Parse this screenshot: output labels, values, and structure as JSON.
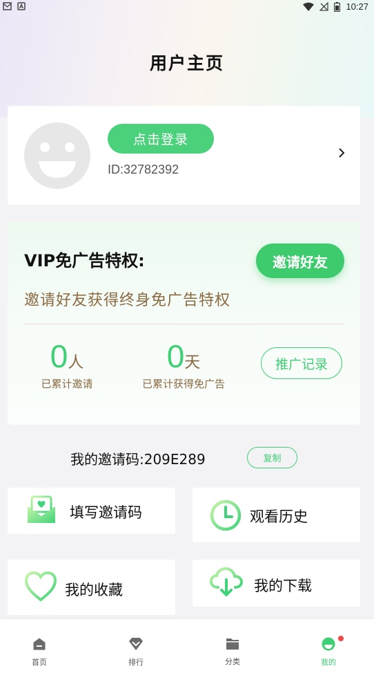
{
  "status_bar": {
    "time": "10:27"
  },
  "page": {
    "title": "用户主页"
  },
  "profile": {
    "login_label": "点击登录",
    "user_id": "ID:32782392"
  },
  "vip": {
    "title": "VIP免广告特权:",
    "invite_label": "邀请好友",
    "subtitle": "邀请好友获得终身免广告特权",
    "invited_count": "0",
    "invited_unit": "人",
    "invited_label": "已累计邀请",
    "days_count": "0",
    "days_unit": "天",
    "days_label": "已累计获得免广告",
    "record_label": "推广记录"
  },
  "invite_code": {
    "label": "我的邀请码:209E289",
    "copy_label": "复制"
  },
  "tiles": {
    "fill_code": "填写邀请码",
    "history": "观看历史",
    "favorites": "我的收藏",
    "downloads": "我的下载"
  },
  "tabbar": {
    "home": "首页",
    "ranking": "排行",
    "category": "分类",
    "mine": "我的"
  },
  "colors": {
    "accent": "#3fcf74",
    "login_button": "#4bd17b",
    "brown_text": "#8a6a42",
    "badge": "#f04848"
  }
}
